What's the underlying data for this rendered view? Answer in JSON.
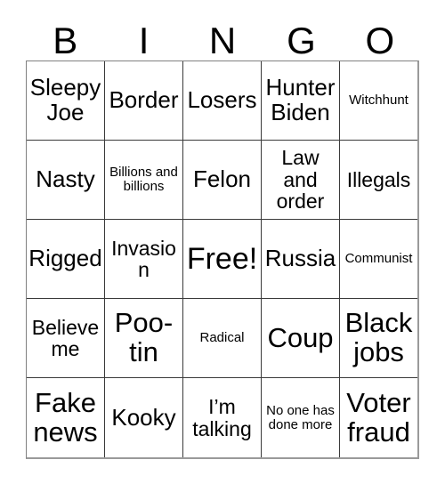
{
  "card": {
    "header_letters": [
      "B",
      "I",
      "N",
      "G",
      "O"
    ],
    "grid_line_color": "#3a3a3a",
    "outer_border_color": "#9a9a9a",
    "background_color": "#ffffff",
    "text_color": "#000000",
    "rows": [
      [
        {
          "text": "Sleepy Joe",
          "size": "fs-md"
        },
        {
          "text": "Border",
          "size": "fs-md"
        },
        {
          "text": "Losers",
          "size": "fs-md"
        },
        {
          "text": "Hunter Biden",
          "size": "fs-md"
        },
        {
          "text": "Witchhunt",
          "size": "fs-xs"
        }
      ],
      [
        {
          "text": "Nasty",
          "size": "fs-md"
        },
        {
          "text": "Billions and billions",
          "size": "fs-xs"
        },
        {
          "text": "Felon",
          "size": "fs-md"
        },
        {
          "text": "Law and order",
          "size": "fs-sm"
        },
        {
          "text": "Illegals",
          "size": "fs-sm"
        }
      ],
      [
        {
          "text": "Rigged",
          "size": "fs-md"
        },
        {
          "text": "Invasion",
          "size": "fs-sm"
        },
        {
          "text": "Free!",
          "size": "fs-xl"
        },
        {
          "text": "Russia",
          "size": "fs-md"
        },
        {
          "text": "Communist",
          "size": "fs-xs"
        }
      ],
      [
        {
          "text": "Believe me",
          "size": "fs-sm"
        },
        {
          "text": "Poo-tin",
          "size": "fs-lg"
        },
        {
          "text": "Radical",
          "size": "fs-xs"
        },
        {
          "text": "Coup",
          "size": "fs-lg"
        },
        {
          "text": "Black jobs",
          "size": "fs-lg"
        }
      ],
      [
        {
          "text": "Fake news",
          "size": "fs-lg"
        },
        {
          "text": "Kooky",
          "size": "fs-md"
        },
        {
          "text": "I’m talking",
          "size": "fs-sm"
        },
        {
          "text": "No one has done more",
          "size": "fs-xs"
        },
        {
          "text": "Voter fraud",
          "size": "fs-lg"
        }
      ]
    ]
  }
}
